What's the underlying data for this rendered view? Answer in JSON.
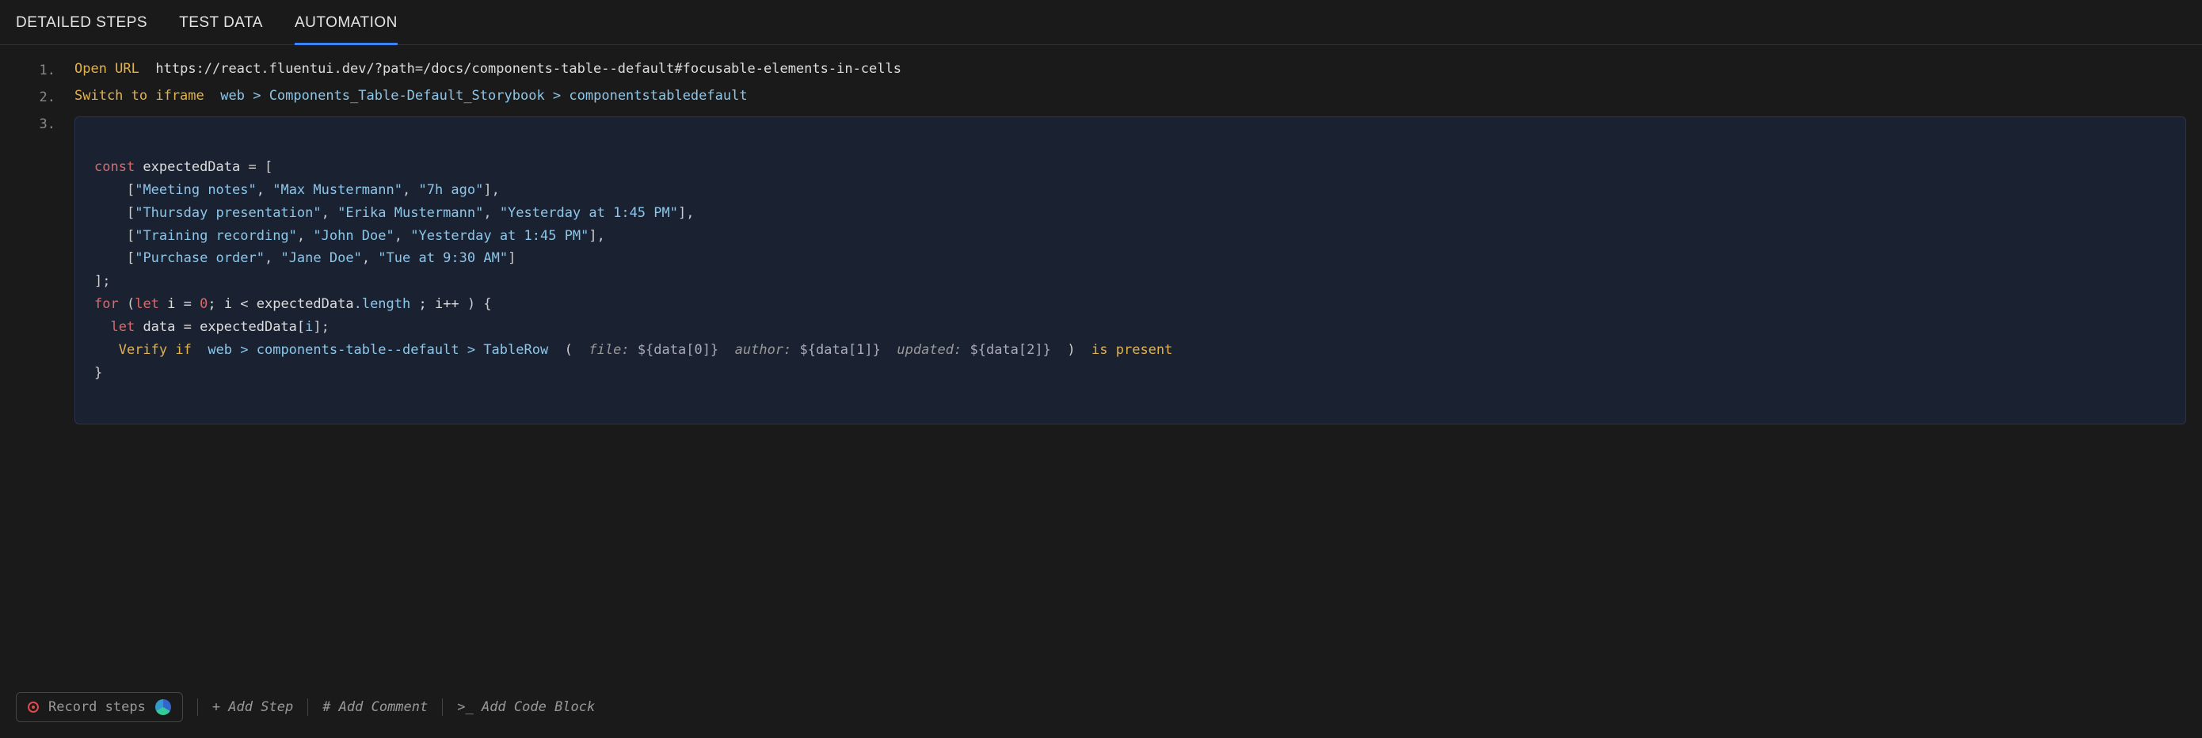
{
  "tabs": {
    "detailed": "DETAILED STEPS",
    "testdata": "TEST DATA",
    "automation": "AUTOMATION",
    "activeIndex": 2
  },
  "steps": {
    "s1": {
      "num": "1.",
      "cmd": "Open URL",
      "url": "https://react.fluentui.dev/?path=/docs/components-table--default#focusable-elements-in-cells"
    },
    "s2": {
      "num": "2.",
      "cmd": "Switch to iframe",
      "p1": "web",
      "sep": " > ",
      "p2": "Components_Table-Default_Storybook",
      "p3": "componentstabledefault"
    },
    "s3": {
      "num": "3."
    }
  },
  "code": {
    "l1_kw": "const",
    "l1_ident": " expectedData ",
    "l1_eq": "= [",
    "rows": {
      "r0a": "\"Meeting notes\"",
      "r0b": "\"Max Mustermann\"",
      "r0c": "\"7h ago\"",
      "r1a": "\"Thursday presentation\"",
      "r1b": "\"Erika Mustermann\"",
      "r1c": "\"Yesterday at 1:45 PM\"",
      "r2a": "\"Training recording\"",
      "r2b": "\"John Doe\"",
      "r2c": "\"Yesterday at 1:45 PM\"",
      "r3a": "\"Purchase order\"",
      "r3b": "\"Jane Doe\"",
      "r3c": "\"Tue at 9:30 AM\""
    },
    "close_arr": "];",
    "for_kw": "for",
    "for_open": " (",
    "let_kw": "let",
    "for_i": " i = ",
    "zero": "0",
    "for_cond": "; i < expectedData",
    "for_len": ".length",
    "for_inc": " ; i++ ",
    "for_close": ") {",
    "let2": "let",
    "let2_body": " data = expectedData[",
    "let2_i": "i",
    "let2_close": "];",
    "verify_cmd": "Verify if",
    "verify_path": "web > components-table--default > TableRow",
    "verify_open": "  (  ",
    "p_file": "file:",
    "v_file": " ${data[0]}  ",
    "p_author": "author:",
    "v_author": " ${data[1]}  ",
    "p_updated": "updated:",
    "v_updated": " ${data[2]}  ",
    "verify_close": ")  ",
    "is_present": "is present",
    "brace_close": "}"
  },
  "bottombar": {
    "record": "Record steps",
    "addstep": "+ Add Step",
    "addcomment": "# Add Comment",
    "addcode": ">_ Add Code Block"
  }
}
